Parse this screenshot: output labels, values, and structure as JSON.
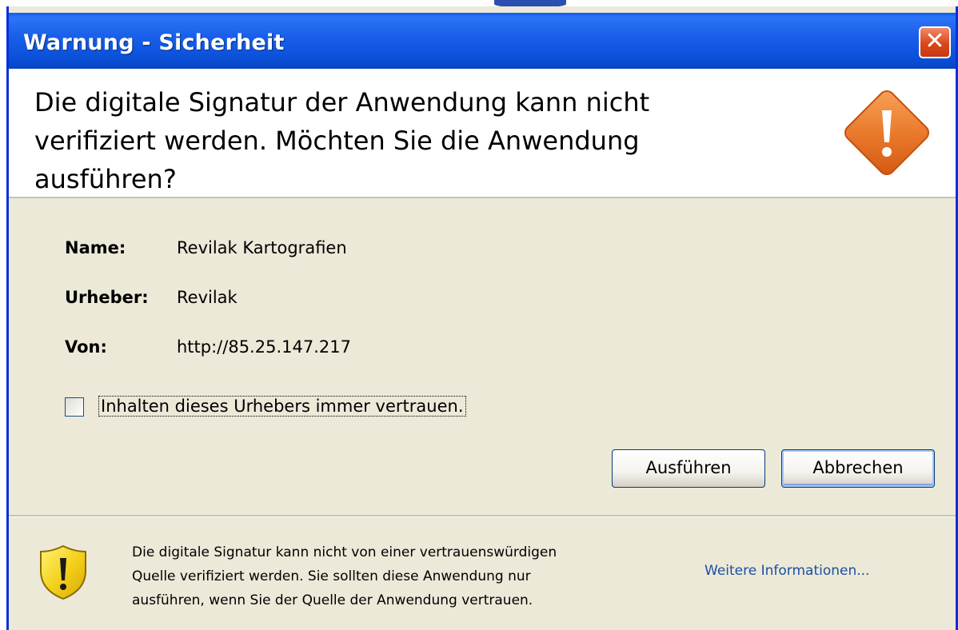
{
  "window": {
    "title": "Warnung - Sicherheit",
    "close_label": "✕"
  },
  "header": {
    "message_line1": "Die digitale Signatur der Anwendung kann nicht",
    "message_line2": "verifiziert werden.  Möchten Sie die Anwendung",
    "message_line3": "ausführen?",
    "icon": "warning-diamond-icon"
  },
  "details": {
    "name_label": "Name:",
    "name_value": "Revilak Kartografien",
    "publisher_label": "Urheber:",
    "publisher_value": "Revilak",
    "from_label": "Von:",
    "from_value": "http://85.25.147.217"
  },
  "trust_checkbox": {
    "label": "Inhalten dieses Urhebers immer vertrauen.",
    "checked": false
  },
  "buttons": {
    "run_label": "Ausführen",
    "cancel_label": "Abbrechen"
  },
  "footer": {
    "line1": "Die digitale Signatur kann nicht von einer vertrauenswürdigen",
    "line2": "Quelle verifiziert werden. Sie sollten diese Anwendung nur",
    "line3": "ausführen, wenn Sie der Quelle der Anwendung vertrauen.",
    "more_info_label": "Weitere Informationen...",
    "icon": "shield-warning-icon"
  },
  "colors": {
    "titlebar": "#0a50d8",
    "dialog_bg": "#ece9d8",
    "warning_orange": "#e8742a",
    "shield_yellow": "#f5d21e",
    "link": "#1c4fa0"
  }
}
